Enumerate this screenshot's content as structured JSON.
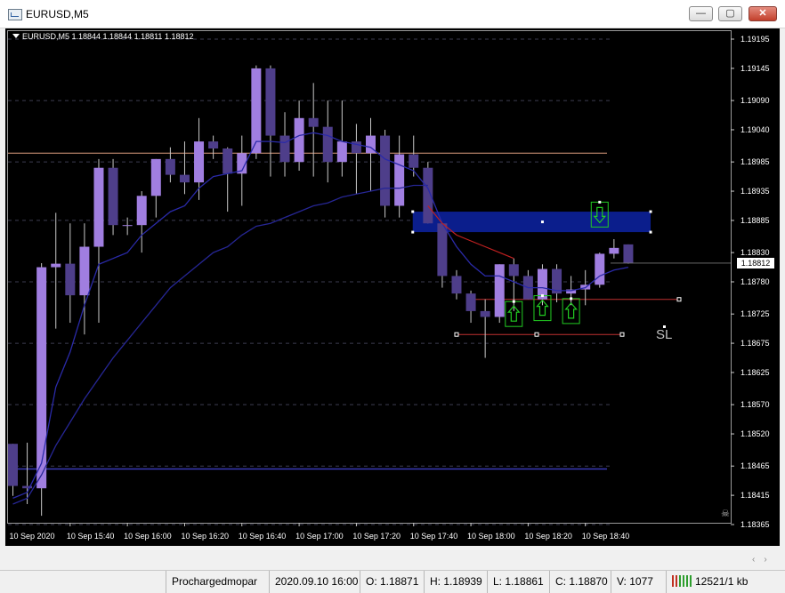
{
  "window": {
    "title": "EURUSD,M5",
    "min_glyph": "—",
    "max_glyph": "▢",
    "close_glyph": "✕"
  },
  "chart": {
    "symbol_line": "EURUSD,M5  1.18844 1.18844 1.18811 1.18812",
    "sl_label": "SL",
    "current_price": "1.18812",
    "price_scale": [
      "1.19195",
      "1.19145",
      "1.19090",
      "1.19040",
      "1.18985",
      "1.18935",
      "1.18885",
      "1.18830",
      "1.18780",
      "1.18725",
      "1.18675",
      "1.18625",
      "1.18570",
      "1.18520",
      "1.18465",
      "1.18415",
      "1.18365"
    ],
    "time_scale": [
      "10 Sep 2020",
      "10 Sep 15:40",
      "10 Sep 16:00",
      "10 Sep 16:20",
      "10 Sep 16:40",
      "10 Sep 17:00",
      "10 Sep 17:20",
      "10 Sep 17:40",
      "10 Sep 18:00",
      "10 Sep 18:20",
      "10 Sep 18:40"
    ],
    "colors": {
      "bull": "#a07ee0",
      "bear": "#4e3e8a",
      "wick": "#c8c8c8",
      "grid": "#3c3c50",
      "ma_fast": "#2a2aa8",
      "ma_slow": "#262694",
      "ma_red": "#c02020",
      "zone": "#0b1e8c",
      "level_orange": "#e0a080",
      "level_blue": "#3a3ab8",
      "arrow": "#22cc22"
    },
    "candles": [
      {
        "o": 1.18503,
        "h": 1.18503,
        "l": 1.18414,
        "c": 1.18431
      },
      {
        "o": 1.18431,
        "h": 1.18505,
        "l": 1.184,
        "c": 1.18427
      },
      {
        "o": 1.18427,
        "h": 1.18812,
        "l": 1.1838,
        "c": 1.18805
      },
      {
        "o": 1.18805,
        "h": 1.18898,
        "l": 1.187,
        "c": 1.18811
      },
      {
        "o": 1.18811,
        "h": 1.1888,
        "l": 1.1871,
        "c": 1.18757
      },
      {
        "o": 1.18757,
        "h": 1.1888,
        "l": 1.1869,
        "c": 1.1884
      },
      {
        "o": 1.1884,
        "h": 1.1899,
        "l": 1.1871,
        "c": 1.18975
      },
      {
        "o": 1.18975,
        "h": 1.1899,
        "l": 1.1886,
        "c": 1.18877
      },
      {
        "o": 1.18877,
        "h": 1.1889,
        "l": 1.1886,
        "c": 1.18877
      },
      {
        "o": 1.18877,
        "h": 1.18935,
        "l": 1.1883,
        "c": 1.18927
      },
      {
        "o": 1.18927,
        "h": 1.1899,
        "l": 1.1889,
        "c": 1.1899
      },
      {
        "o": 1.1899,
        "h": 1.1901,
        "l": 1.1895,
        "c": 1.18963
      },
      {
        "o": 1.18963,
        "h": 1.1902,
        "l": 1.1893,
        "c": 1.1895
      },
      {
        "o": 1.1895,
        "h": 1.1906,
        "l": 1.1892,
        "c": 1.1902
      },
      {
        "o": 1.1902,
        "h": 1.1903,
        "l": 1.1899,
        "c": 1.19008
      },
      {
        "o": 1.19008,
        "h": 1.1901,
        "l": 1.189,
        "c": 1.18965
      },
      {
        "o": 1.18965,
        "h": 1.1903,
        "l": 1.1891,
        "c": 1.19
      },
      {
        "o": 1.19,
        "h": 1.1915,
        "l": 1.1899,
        "c": 1.19145
      },
      {
        "o": 1.19145,
        "h": 1.1915,
        "l": 1.1896,
        "c": 1.1903
      },
      {
        "o": 1.1903,
        "h": 1.1907,
        "l": 1.1896,
        "c": 1.18985
      },
      {
        "o": 1.18985,
        "h": 1.1909,
        "l": 1.1897,
        "c": 1.1906
      },
      {
        "o": 1.1906,
        "h": 1.1912,
        "l": 1.1896,
        "c": 1.19045
      },
      {
        "o": 1.19045,
        "h": 1.1909,
        "l": 1.1895,
        "c": 1.18985
      },
      {
        "o": 1.18985,
        "h": 1.1909,
        "l": 1.1896,
        "c": 1.1902
      },
      {
        "o": 1.1902,
        "h": 1.1905,
        "l": 1.1893,
        "c": 1.19
      },
      {
        "o": 1.19,
        "h": 1.1906,
        "l": 1.18935,
        "c": 1.1903
      },
      {
        "o": 1.1903,
        "h": 1.1904,
        "l": 1.1889,
        "c": 1.1891
      },
      {
        "o": 1.1891,
        "h": 1.1903,
        "l": 1.1889,
        "c": 1.18998
      },
      {
        "o": 1.18998,
        "h": 1.1903,
        "l": 1.1896,
        "c": 1.18975
      },
      {
        "o": 1.18975,
        "h": 1.18985,
        "l": 1.1888,
        "c": 1.1888
      },
      {
        "o": 1.1888,
        "h": 1.1888,
        "l": 1.1877,
        "c": 1.1879
      },
      {
        "o": 1.1879,
        "h": 1.188,
        "l": 1.1875,
        "c": 1.1876
      },
      {
        "o": 1.1876,
        "h": 1.18765,
        "l": 1.1871,
        "c": 1.1873
      },
      {
        "o": 1.1873,
        "h": 1.1875,
        "l": 1.1865,
        "c": 1.1872
      },
      {
        "o": 1.1872,
        "h": 1.1881,
        "l": 1.1871,
        "c": 1.1881
      },
      {
        "o": 1.1881,
        "h": 1.1882,
        "l": 1.1873,
        "c": 1.1879
      },
      {
        "o": 1.1879,
        "h": 1.188,
        "l": 1.1875,
        "c": 1.1875
      },
      {
        "o": 1.1875,
        "h": 1.1881,
        "l": 1.1874,
        "c": 1.18802
      },
      {
        "o": 1.18802,
        "h": 1.1881,
        "l": 1.18745,
        "c": 1.1876
      },
      {
        "o": 1.1876,
        "h": 1.1879,
        "l": 1.1874,
        "c": 1.18767
      },
      {
        "o": 1.18767,
        "h": 1.188,
        "l": 1.1874,
        "c": 1.18775
      },
      {
        "o": 1.18775,
        "h": 1.1883,
        "l": 1.1877,
        "c": 1.18828
      },
      {
        "o": 1.18828,
        "h": 1.18853,
        "l": 1.1882,
        "c": 1.18838
      },
      {
        "o": 1.18844,
        "h": 1.18844,
        "l": 1.18811,
        "c": 1.18812
      }
    ],
    "ma_fast": [
      1.1841,
      1.1842,
      1.1847,
      1.186,
      1.1866,
      1.1874,
      1.1881,
      1.1882,
      1.1883,
      1.1886,
      1.1888,
      1.189,
      1.1891,
      1.1894,
      1.1896,
      1.18965,
      1.1897,
      1.1902,
      1.1902,
      1.19018,
      1.1903,
      1.19035,
      1.1903,
      1.1902,
      1.19015,
      1.1901,
      1.1899,
      1.1898,
      1.1897,
      1.1894,
      1.1888,
      1.1884,
      1.1881,
      1.1879,
      1.1879,
      1.1878,
      1.1877,
      1.1877,
      1.18765,
      1.18765,
      1.1877,
      1.1879,
      1.188,
      1.18805
    ],
    "ma_slow": [
      1.184,
      1.1841,
      1.1845,
      1.185,
      1.1854,
      1.1858,
      1.18615,
      1.1865,
      1.1868,
      1.1871,
      1.1874,
      1.1877,
      1.1879,
      1.1881,
      1.1883,
      1.1884,
      1.1886,
      1.18875,
      1.1888,
      1.1889,
      1.189,
      1.1891,
      1.18915,
      1.18925,
      1.1893,
      1.18935,
      1.1894,
      1.1894,
      1.18945,
      1.18945
    ],
    "ma_red": [
      1.1891,
      1.1888,
      1.1886,
      1.1885,
      1.1884,
      1.1883,
      1.1882
    ],
    "levels": {
      "orange": 1.19,
      "blue": 1.1846,
      "red_upper": 1.1875,
      "red_lower": 1.1869
    },
    "zone": {
      "top": 1.189,
      "bottom": 1.18865
    },
    "arrows": [
      {
        "index": 35,
        "price": 1.18725,
        "dir": "up"
      },
      {
        "index": 37,
        "price": 1.18735,
        "dir": "up"
      },
      {
        "index": 39,
        "price": 1.1873,
        "dir": "up"
      },
      {
        "index": 41,
        "price": 1.18895,
        "dir": "down"
      }
    ]
  },
  "status": {
    "profile": "Prochargedmopar",
    "datetime": "2020.09.10 16:00",
    "open": "O: 1.18871",
    "high": "H: 1.18939",
    "low": "L: 1.18861",
    "close": "C: 1.18870",
    "volume": "V: 1077",
    "traffic": "12521/1 kb"
  }
}
